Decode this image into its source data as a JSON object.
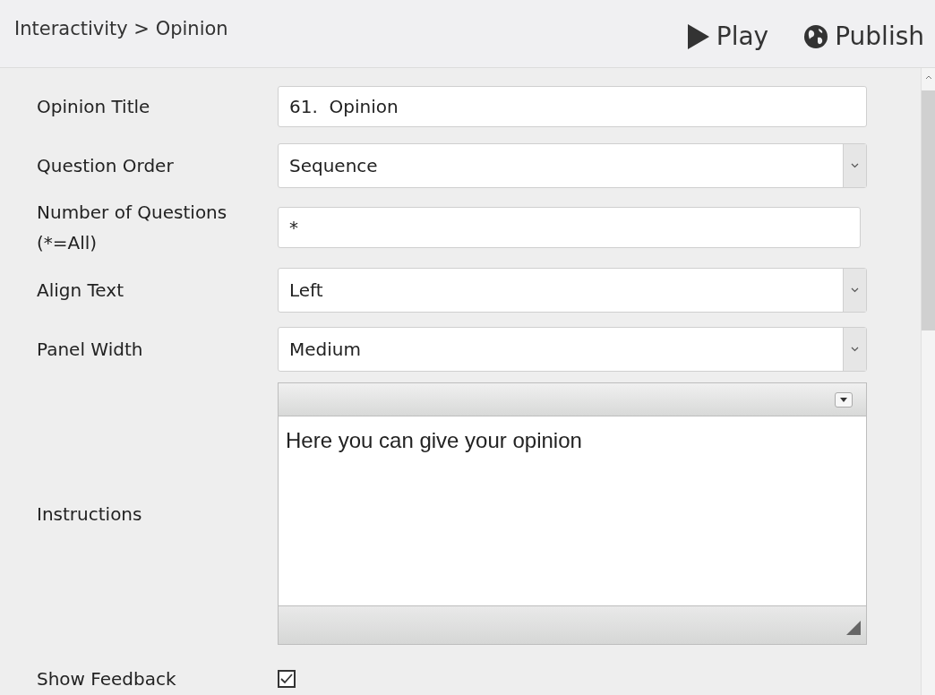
{
  "breadcrumb": "Interactivity > Opinion",
  "actions": [
    {
      "kind": "play",
      "label": "Play"
    },
    {
      "kind": "publish",
      "label": "Publish"
    }
  ],
  "fields": [
    {
      "kind": "text",
      "label": "Opinion Title",
      "value": "61.  Opinion"
    },
    {
      "kind": "select",
      "label": "Question Order",
      "value": "Sequence"
    },
    {
      "kind": "text",
      "label": "Number of Questions (*=All)",
      "value": "*"
    },
    {
      "kind": "select",
      "label": "Align Text",
      "value": "Left"
    },
    {
      "kind": "select",
      "label": "Panel Width",
      "value": "Medium"
    },
    {
      "kind": "editor",
      "label": "Instructions",
      "value": "Here you can give your opinion"
    },
    {
      "kind": "checkbox",
      "label": "Show Feedback",
      "checked": true
    }
  ]
}
